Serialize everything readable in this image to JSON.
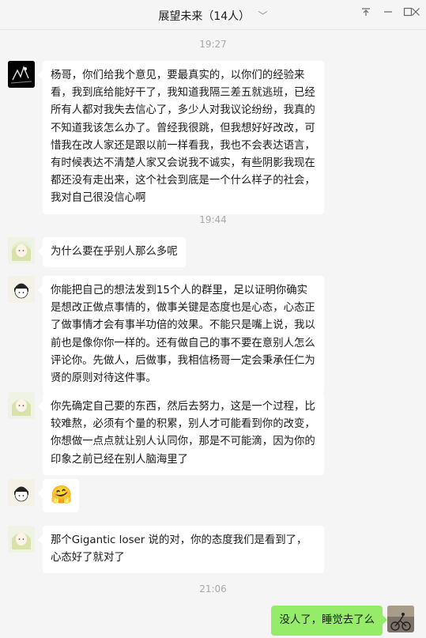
{
  "window": {
    "title": "展望未来（14人）",
    "dropdown_glyph": "﹀",
    "controls": {
      "pin": "⊤",
      "minimize": "—",
      "maximize": "□",
      "close": "✕"
    }
  },
  "timestamps": [
    "19:27",
    "19:44",
    "21:06"
  ],
  "messages": [
    {
      "sender_avatar": "dark-figure-avatar",
      "side": "left",
      "text": "杨哥，你们给我个意见，要最真实的，以你们的经验来看，我到底给能好干了，我知道我隔三差五就逃班，已经所有人都对我失去信心了，多少人对我议论纷纷，我真的不知道我该怎么办了。曾经我很跳，但我想好好改改，可惜我在改人家还是跟以前一样看我，我也不会表达语言，有时候表达不清楚人家又会说我不诚实，有些阴影我现在都还没有走出来，这个社会到底是一个什么样子的社会，我对自己很没信心啊"
    },
    {
      "sender_avatar": "girl-cartoon-avatar",
      "side": "left",
      "text": "为什么要在乎别人那么多呢"
    },
    {
      "sender_avatar": "boy-sketch-avatar",
      "side": "left",
      "text": "你能把自己的想法发到15个人的群里，足以证明你确实是想改正做点事情的，做事关键是态度也是心态，心态正了做事情才会有事半功倍的效果。不能只是嘴上说，我以前也是像你你一样的。还有做自己的事不要在意别人怎么评论你。先做人，后做事，我相信杨哥一定会秉承任仁为贤的原则对待这件事。"
    },
    {
      "sender_avatar": "girl-cartoon-avatar",
      "side": "left",
      "text": "你先确定自己要的东西，然后去努力，这是一个过程，比较难熬，必须有个量的积累，别人才可能看到你的改变，你想做一点点就让别人认同你，那是不可能滴，因为你的印象之前已经在别人脑海里了"
    },
    {
      "sender_avatar": "boy-sketch-avatar",
      "side": "left",
      "text": "🤗"
    },
    {
      "sender_avatar": "girl-cartoon-avatar",
      "side": "left",
      "text": "那个Gigantic loser  说的对，你的态度我们是看到了，心态好了就对了"
    },
    {
      "sender_avatar": "cyclist-photo-avatar",
      "side": "right",
      "text": "没人了，睡觉去了么"
    }
  ],
  "colors": {
    "bg": "#f5f5f5",
    "bubble_in": "#ffffff",
    "bubble_out": "#95ec69",
    "timestamp": "#a8a8a8"
  }
}
